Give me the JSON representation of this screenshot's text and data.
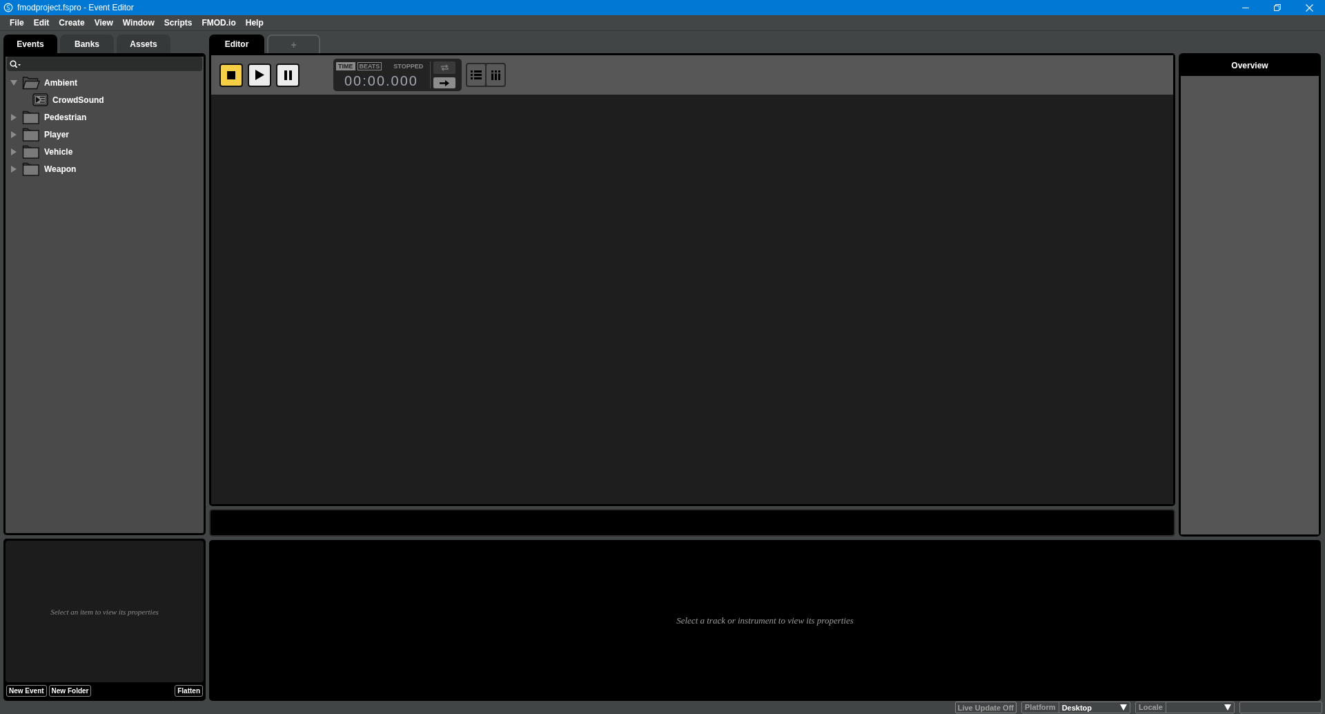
{
  "window": {
    "title": "fmodproject.fspro - Event Editor"
  },
  "menu": [
    "File",
    "Edit",
    "Create",
    "View",
    "Window",
    "Scripts",
    "FMOD.io",
    "Help"
  ],
  "browser": {
    "tabs": [
      {
        "label": "Events",
        "selected": true
      },
      {
        "label": "Banks",
        "selected": false
      },
      {
        "label": "Assets",
        "selected": false
      }
    ],
    "tree": [
      {
        "label": "Ambient",
        "kind": "folder",
        "expanded": true,
        "children": [
          {
            "label": "CrowdSound",
            "kind": "event"
          }
        ]
      },
      {
        "label": "Pedestrian",
        "kind": "folder",
        "expanded": false
      },
      {
        "label": "Player",
        "kind": "folder",
        "expanded": false
      },
      {
        "label": "Vehicle",
        "kind": "folder",
        "expanded": false
      },
      {
        "label": "Weapon",
        "kind": "folder",
        "expanded": false
      }
    ]
  },
  "properties": {
    "message": "Select an item to view its properties",
    "buttons": [
      "New Event",
      "New Folder"
    ],
    "end_button": "Flatten"
  },
  "editor": {
    "tabs": [
      {
        "label": "Editor",
        "selected": true
      },
      {
        "label": "+",
        "selected": false
      }
    ],
    "transport": [
      {
        "kind": "stop",
        "selected": true
      },
      {
        "kind": "play",
        "selected": false
      },
      {
        "kind": "pause",
        "selected": false
      }
    ],
    "time_modes": [
      {
        "label": "TIME",
        "selected": true
      },
      {
        "label": "BEATS",
        "selected": false
      }
    ],
    "status": "STOPPED",
    "time": "00:00.000",
    "toggles": [
      {
        "kind": "loop",
        "on": false
      },
      {
        "kind": "arrow",
        "on": true
      }
    ],
    "views": [
      {
        "kind": "list"
      },
      {
        "kind": "columns"
      }
    ]
  },
  "overview": {
    "title": "Overview"
  },
  "deck": {
    "message": "Select a track or instrument to view its properties"
  },
  "status_bar": {
    "live_update": "Live Update Off",
    "platform": {
      "label": "Platform",
      "value": "Desktop"
    },
    "locale": {
      "label": "Locale"
    }
  }
}
